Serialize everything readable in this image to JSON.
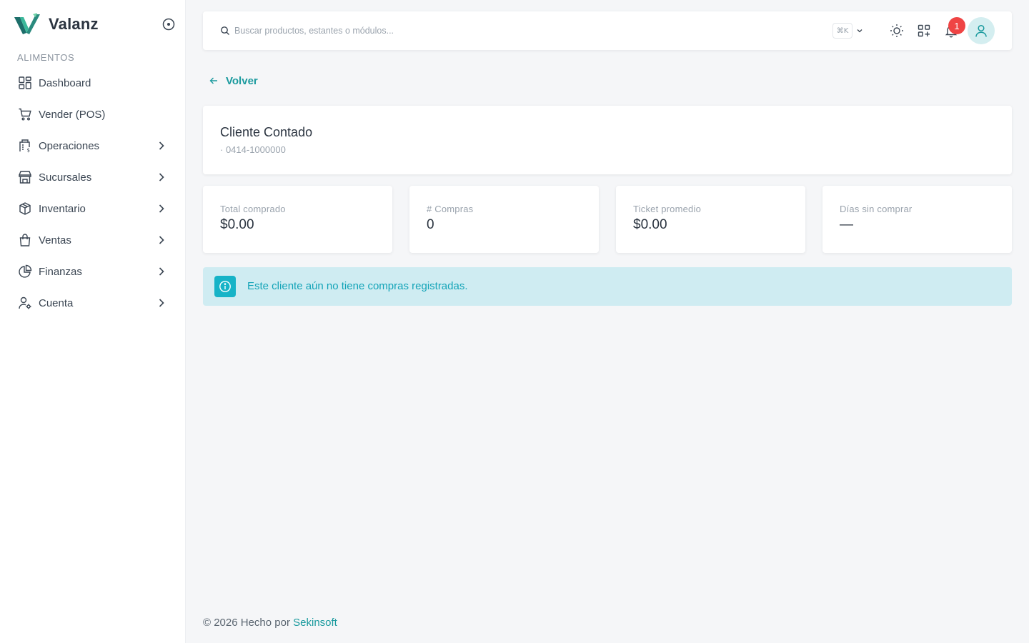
{
  "brand": {
    "name": "Valanz"
  },
  "sidebar": {
    "section_title": "ALIMENTOS",
    "items": [
      {
        "label": "Dashboard",
        "icon": "dashboard-grid-icon",
        "has_submenu": false
      },
      {
        "label": "Vender (POS)",
        "icon": "cart-icon",
        "has_submenu": false
      },
      {
        "label": "Operaciones",
        "icon": "operations-doc-icon",
        "has_submenu": true
      },
      {
        "label": "Sucursales",
        "icon": "store-icon",
        "has_submenu": true
      },
      {
        "label": "Inventario",
        "icon": "box-icon",
        "has_submenu": true
      },
      {
        "label": "Ventas",
        "icon": "shopping-bag-icon",
        "has_submenu": true
      },
      {
        "label": "Finanzas",
        "icon": "pie-chart-icon",
        "has_submenu": true
      },
      {
        "label": "Cuenta",
        "icon": "user-settings-icon",
        "has_submenu": true
      }
    ]
  },
  "topbar": {
    "search_placeholder": "Buscar productos, estantes o módulos...",
    "shortcut": "⌘K",
    "notification_count": "1"
  },
  "back": {
    "label": "Volver"
  },
  "customer": {
    "name": "Cliente Contado",
    "phone": "· 0414-1000000"
  },
  "stats": [
    {
      "label": "Total comprado",
      "value": "$0.00"
    },
    {
      "label": "# Compras",
      "value": "0"
    },
    {
      "label": "Ticket promedio",
      "value": "$0.00"
    },
    {
      "label": "Días sin comprar",
      "value": "—"
    }
  ],
  "alert": {
    "text": "Este cliente aún no tiene compras registradas."
  },
  "footer": {
    "prefix": "© 2026 Hecho por",
    "brand": "Sekinsoft"
  },
  "colors": {
    "accent": "#1a9a9e",
    "alert_bg": "#cfecf2",
    "alert_icon": "#16b3c7",
    "badge": "#ef4444"
  }
}
